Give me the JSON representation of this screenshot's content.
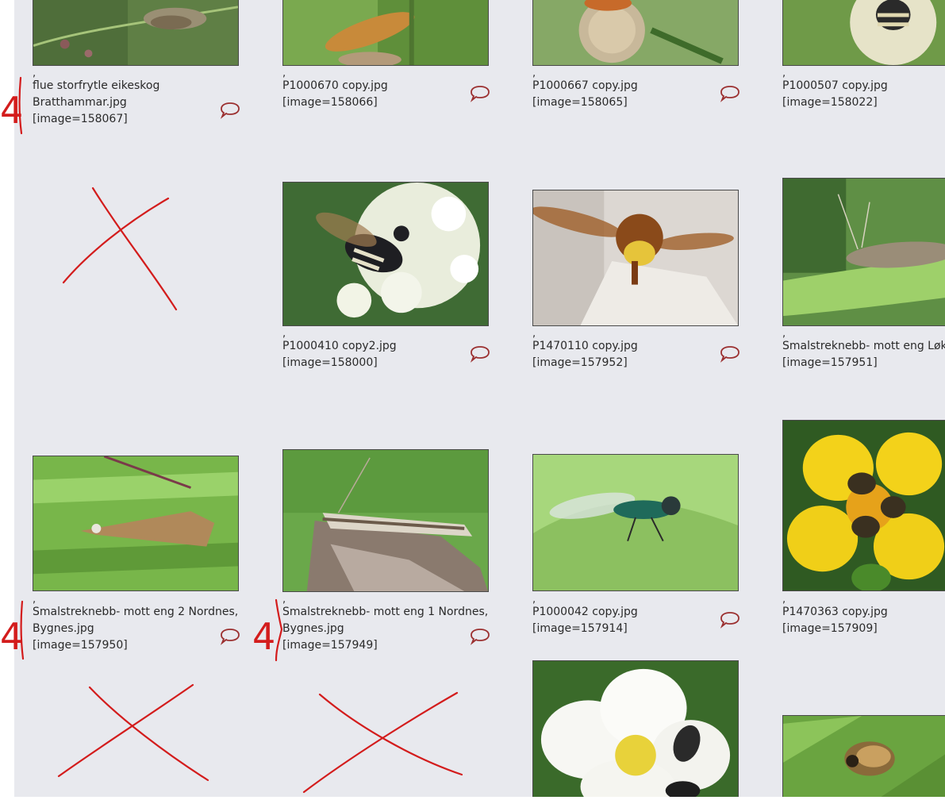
{
  "gallery": {
    "items": [
      {
        "comma": ",",
        "name": "flue storfrytle eikeskog Bratthammar.jpg",
        "tag": "[image=158067]"
      },
      {
        "comma": ",",
        "name": "P1000670 copy.jpg",
        "tag": "[image=158066]"
      },
      {
        "comma": ",",
        "name": "P1000667 copy.jpg",
        "tag": "[image=158065]"
      },
      {
        "comma": ",",
        "name": "P1000507 copy.jpg",
        "tag": "[image=158022]"
      },
      {
        "comma": ",",
        "name": "P1000410 copy2.jpg",
        "tag": "[image=158000]"
      },
      {
        "comma": ",",
        "name": "P1470110 copy.jpg",
        "tag": "[image=157952]"
      },
      {
        "comma": ",",
        "name": "Smalstreknebb- mott eng Løkje",
        "tag": "[image=157951]"
      },
      {
        "comma": ",",
        "name": "Smalstreknebb- mott eng 2 Nordnes, Bygnes.jpg",
        "tag": "[image=157950]"
      },
      {
        "comma": ",",
        "name": "Smalstreknebb- mott eng 1 Nordnes, Bygnes.jpg",
        "tag": "[image=157949]"
      },
      {
        "comma": ",",
        "name": "P1000042 copy.jpg",
        "tag": "[image=157914]"
      },
      {
        "comma": ",",
        "name": "P1470363 copy.jpg",
        "tag": "[image=157909]"
      }
    ]
  },
  "annotations": {
    "mark_label": "4"
  },
  "colors": {
    "background": "#e8e9ee",
    "comment_icon": "#9b2f2f",
    "annotation_ink": "#d31c1c"
  }
}
